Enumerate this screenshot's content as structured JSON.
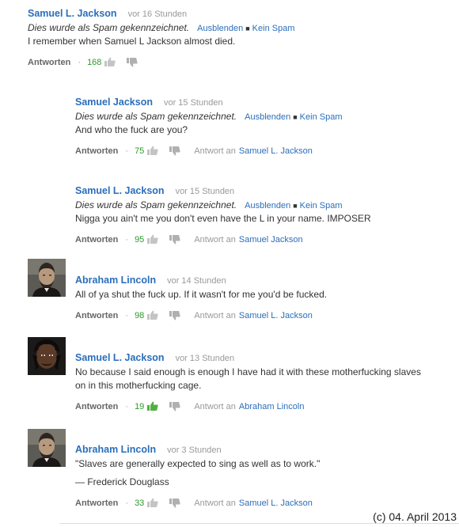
{
  "labels": {
    "spam_notice": "Dies wurde als Spam gekennzeichnet.",
    "hide": "Ausblenden",
    "not_spam": "Kein Spam",
    "reply": "Antworten",
    "reply_to": "Antwort an"
  },
  "comments": [
    {
      "author": "Samuel L. Jackson",
      "time": "vor 16 Stunden",
      "spam": true,
      "lines": [
        "I remember when Samuel L Jackson almost died."
      ],
      "likes": "168",
      "reply_to": ""
    },
    {
      "author": "Samuel Jackson",
      "time": "vor 15 Stunden",
      "spam": true,
      "lines": [
        "And who the fuck are you?"
      ],
      "likes": "75",
      "reply_to": "Samuel L. Jackson"
    },
    {
      "author": "Samuel L. Jackson",
      "time": "vor 15 Stunden",
      "spam": true,
      "lines": [
        "Nigga you ain't me you don't even have the L in your name. IMPOSER"
      ],
      "likes": "95",
      "reply_to": "Samuel Jackson"
    },
    {
      "author": "Abraham Lincoln",
      "time": "vor 14 Stunden",
      "spam": false,
      "lines": [
        "All of ya shut the fuck up. If it wasn't for me you'd be fucked."
      ],
      "likes": "98",
      "reply_to": "Samuel L. Jackson",
      "avatar": "lincoln-avatar"
    },
    {
      "author": "Samuel L. Jackson",
      "time": "vor 13 Stunden",
      "spam": false,
      "lines": [
        "No because I said enough is enough I have had it with these motherfucking slaves",
        "on in this motherfucking cage."
      ],
      "likes": "19",
      "liked": true,
      "reply_to": "Abraham Lincoln",
      "avatar": "jackson-avatar"
    },
    {
      "author": "Abraham Lincoln",
      "time": "vor 3 Stunden",
      "spam": false,
      "lines": [
        "\"Slaves are generally expected to sing as well as to work.\"",
        "— Frederick Douglass"
      ],
      "likes": "33",
      "reply_to": "Samuel L. Jackson",
      "avatar": "lincoln-avatar"
    }
  ],
  "copyright": "(c) 04. April 2013",
  "colors": {
    "link": "#2a6ebb",
    "likes": "#2d9a2d",
    "muted": "#999999"
  }
}
